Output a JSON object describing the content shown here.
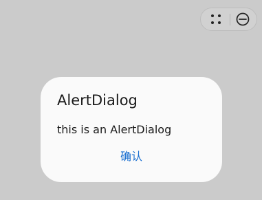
{
  "capsule": {
    "more_icon": "four-dots-icon",
    "close_icon": "minus-circle-icon"
  },
  "dialog": {
    "title": "AlertDialog",
    "message": "this is an AlertDialog",
    "confirm_label": "确认"
  },
  "colors": {
    "overlay_background": "#cbcbcb",
    "dialog_background": "#fafafa",
    "accent": "#1a6fd0",
    "text": "#1a1a1a"
  }
}
